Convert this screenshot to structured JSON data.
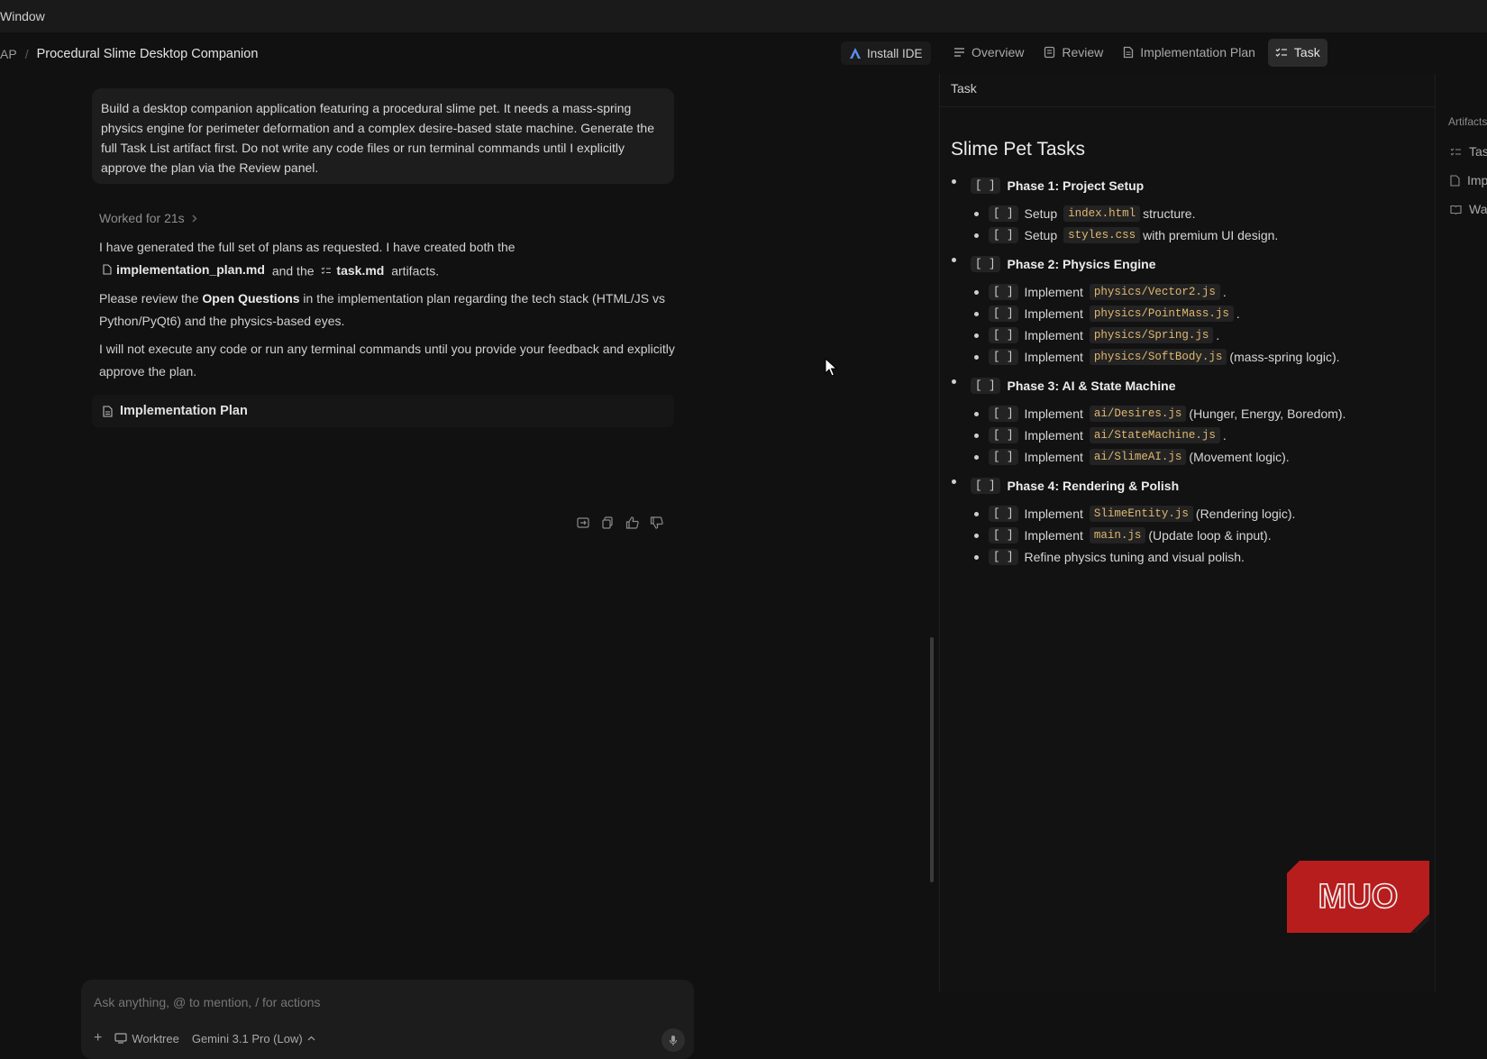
{
  "menubar": {
    "label": "Window"
  },
  "breadcrumb": {
    "parent": "AP",
    "current": "Procedural Slime Desktop Companion"
  },
  "header": {
    "install_label": "Install IDE",
    "tabs": [
      {
        "label": "Overview",
        "icon": "lines-icon"
      },
      {
        "label": "Review",
        "icon": "review-icon"
      },
      {
        "label": "Implementation Plan",
        "icon": "document-icon"
      },
      {
        "label": "Task",
        "icon": "checklist-icon",
        "active": true
      }
    ]
  },
  "chat": {
    "user_prompt": "Build a desktop companion application featuring a procedural slime pet. It needs a mass-spring physics engine for perimeter deformation and a complex desire-based state machine. Generate the full Task List artifact first. Do not write any code files or run terminal commands until I explicitly approve the plan via the Review panel.",
    "worked_for": "Worked for 21s",
    "response": {
      "p1_start": "I have generated the full set of plans as requested. I have created both the",
      "file1": "implementation_plan.md",
      "p1_mid": "and the",
      "file2": "task.md",
      "p1_end": "artifacts.",
      "p2_start": "Please review the",
      "p2_bold": "Open Questions",
      "p2_end": "in the implementation plan regarding the tech stack (HTML/JS vs Python/PyQt6) and the physics-based eyes.",
      "p3": "I will not execute any code or run any terminal commands until you provide your feedback and explicitly approve the plan."
    },
    "plan_card_label": "Implementation Plan"
  },
  "input": {
    "placeholder": "Ask anything, @ to mention, / for actions",
    "add_label": "+",
    "worktree_label": "Worktree",
    "model_label": "Gemini 3.1 Pro (Low)"
  },
  "task_panel": {
    "header": "Task",
    "title": "Slime Pet Tasks",
    "checkbox": "[ ]",
    "phases": [
      {
        "title": "Phase 1: Project Setup",
        "items": [
          {
            "pre": "Setup",
            "code": "index.html",
            "post": "structure."
          },
          {
            "pre": "Setup",
            "code": "styles.css",
            "post": "with premium UI design."
          }
        ]
      },
      {
        "title": "Phase 2: Physics Engine",
        "items": [
          {
            "pre": "Implement",
            "code": "physics/Vector2.js",
            "post": "."
          },
          {
            "pre": "Implement",
            "code": "physics/PointMass.js",
            "post": "."
          },
          {
            "pre": "Implement",
            "code": "physics/Spring.js",
            "post": "."
          },
          {
            "pre": "Implement",
            "code": "physics/SoftBody.js",
            "post": "(mass-spring logic)."
          }
        ]
      },
      {
        "title": "Phase 3: AI & State Machine",
        "items": [
          {
            "pre": "Implement",
            "code": "ai/Desires.js",
            "post": "(Hunger, Energy, Boredom)."
          },
          {
            "pre": "Implement",
            "code": "ai/StateMachine.js",
            "post": "."
          },
          {
            "pre": "Implement",
            "code": "ai/SlimeAI.js",
            "post": "(Movement logic)."
          }
        ]
      },
      {
        "title": "Phase 4: Rendering & Polish",
        "items": [
          {
            "pre": "Implement",
            "code": "SlimeEntity.js",
            "post": "(Rendering logic)."
          },
          {
            "pre": "Implement",
            "code": "main.js",
            "post": "(Update loop & input)."
          },
          {
            "pre": "Refine physics tuning and visual polish.",
            "code": "",
            "post": ""
          }
        ]
      }
    ]
  },
  "artifacts": {
    "label": "Artifacts",
    "items": [
      "Task",
      "Implementation Plan",
      "Walkthrough"
    ]
  },
  "watermark": {
    "text": "MUO",
    "color": "#b81d1d"
  }
}
